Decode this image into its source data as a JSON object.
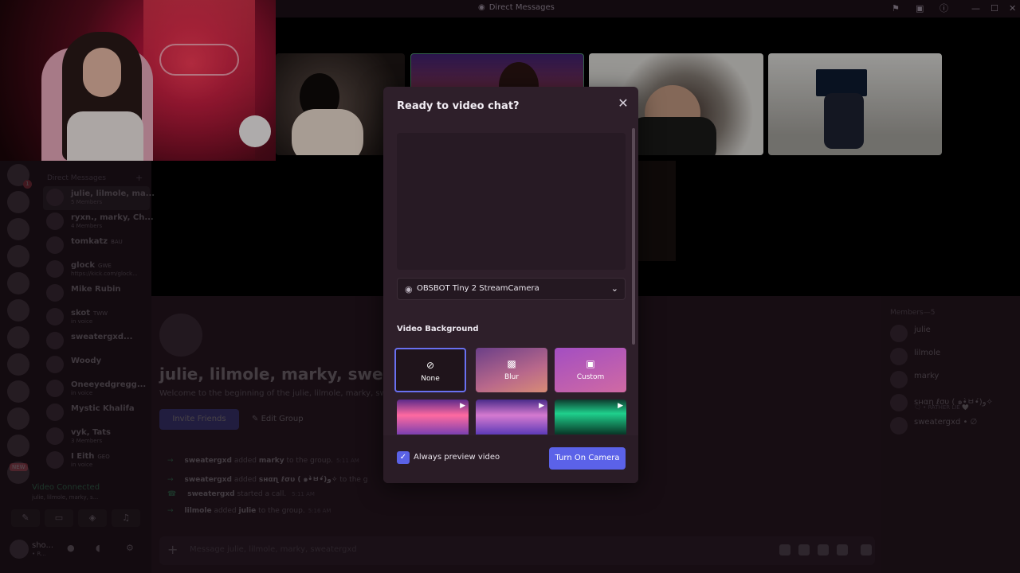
{
  "window": {
    "title": "Direct Messages",
    "controls": [
      "inbox-icon",
      "monitor-icon",
      "help-icon",
      "minimize",
      "maximize",
      "close"
    ]
  },
  "servers": [
    {
      "badge": "1"
    },
    {
      "badge": ""
    },
    {
      "badge": ""
    },
    {
      "badge": ""
    },
    {
      "badge": ""
    },
    {
      "badge": ""
    },
    {
      "badge": ""
    },
    {
      "badge": ""
    },
    {
      "badge": ""
    },
    {
      "badge": ""
    },
    {
      "badge": ""
    },
    {
      "badge": ""
    }
  ],
  "new_label": "NEW",
  "dm": {
    "header": "Direct Messages",
    "items": [
      {
        "name": "julie, lilmole, ma...",
        "sub": "5 Members",
        "tag": ""
      },
      {
        "name": "ryxn., marky, Ch...",
        "sub": "4 Members",
        "tag": ""
      },
      {
        "name": "tomkatz",
        "sub": "",
        "tag": "BAU"
      },
      {
        "name": "glock",
        "sub": "https://kick.com/glock...",
        "tag": "GWE"
      },
      {
        "name": "Mike Rubin",
        "sub": "",
        "tag": ""
      },
      {
        "name": "skot",
        "sub": "in voice",
        "tag": "TWW"
      },
      {
        "name": "sweatergxd...",
        "sub": "",
        "tag": ""
      },
      {
        "name": "Woody",
        "sub": "",
        "tag": ""
      },
      {
        "name": "Oneeyedgregg...",
        "sub": "in voice",
        "tag": ""
      },
      {
        "name": "Mystic Khalifa",
        "sub": "",
        "tag": ""
      },
      {
        "name": "vyk, Tats",
        "sub": "3 Members",
        "tag": ""
      },
      {
        "name": "I Eith",
        "sub": "in voice",
        "tag": "GEO"
      }
    ]
  },
  "voice": {
    "title": "Video Connected",
    "sub": "julie, lilmole, marky, s...",
    "buttons": [
      "camera-off-icon",
      "screen-share-icon",
      "activity-icon",
      "soundboard-icon"
    ]
  },
  "user": {
    "name": "sho...",
    "status": "• R..."
  },
  "chat": {
    "title": "julie, lilmole, marky, sweaterg",
    "welcome": "Welcome to the beginning of the julie, lilmole, marky, sweater",
    "invite_label": "Invite Friends",
    "edit_label": "Edit Group",
    "messages": [
      {
        "actor": "sweatergxd",
        "text": "added",
        "target": "marky",
        "rest": "to the group.",
        "ts": "5:11 AM"
      },
      {
        "actor": "sweatergxd",
        "text": "added",
        "target": "ѕнαɳ ℓσυ ( ๑•̀ㅂ•́)و✧",
        "rest": "to the g",
        "ts": ""
      },
      {
        "actor": "sweatergxd",
        "text": "started a call.",
        "target": "",
        "rest": "",
        "ts": "5:11 AM"
      },
      {
        "actor": "lilmole",
        "text": "added",
        "target": "julie",
        "rest": "to the group.",
        "ts": "5:16 AM"
      }
    ],
    "composer_placeholder": "Message julie, lilmole, marky, sweatergxd"
  },
  "members": {
    "header": "Members—5",
    "list": [
      {
        "name": "julie",
        "sub": ""
      },
      {
        "name": "lilmole",
        "sub": ""
      },
      {
        "name": "marky",
        "sub": ""
      },
      {
        "name": "ѕнαɳ ℓσυ ( ๑•̀ㅂ•́)و✧",
        "sub": "🗨 • RATHER LIE 🤍"
      },
      {
        "name": "sweatergxd • ∅",
        "sub": ""
      }
    ]
  },
  "modal": {
    "title": "Ready to video chat?",
    "camera_label": "OBSBOT Tiny 2 StreamCamera",
    "video_background_label": "Video Background",
    "options": [
      {
        "label": "None",
        "icon": "none-icon",
        "selected": true
      },
      {
        "label": "Blur",
        "icon": "blur-icon",
        "selected": false
      },
      {
        "label": "Custom",
        "icon": "custom-image-icon",
        "selected": false
      }
    ],
    "always_preview_label": "Always preview video",
    "always_preview_checked": true,
    "turn_on_label": "Turn On Camera",
    "accent_color": "#5b62e8"
  }
}
